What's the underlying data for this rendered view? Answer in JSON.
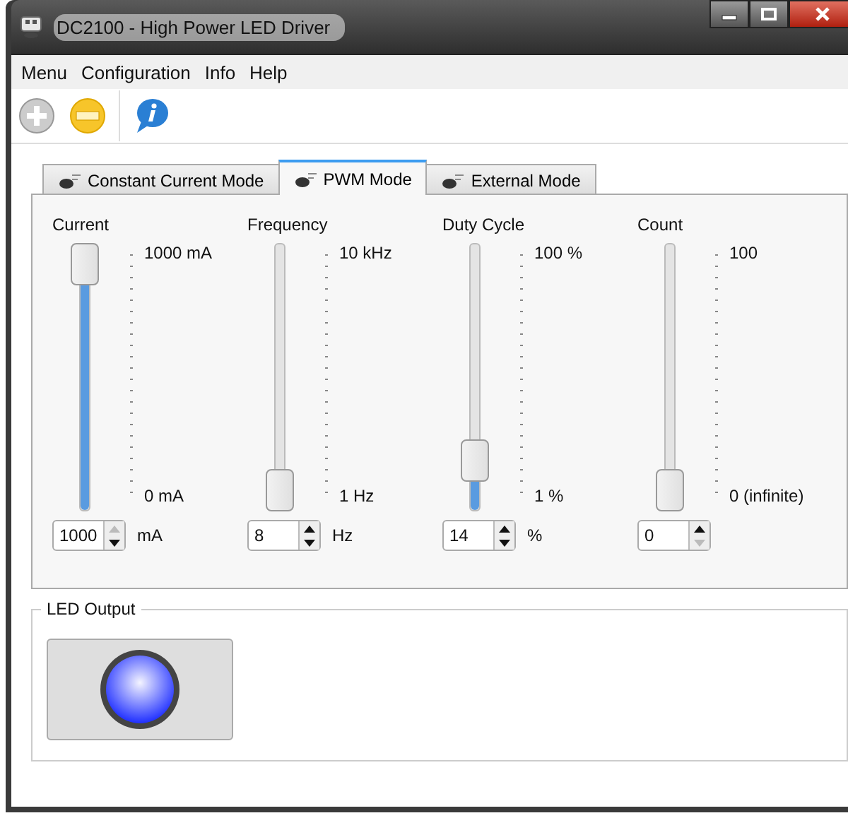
{
  "window": {
    "title": "DC2100 - High Power LED Driver"
  },
  "menu": [
    "Menu",
    "Configuration",
    "Info",
    "Help"
  ],
  "tabs": [
    {
      "label": "Constant Current Mode",
      "selected": false
    },
    {
      "label": "PWM Mode",
      "selected": true
    },
    {
      "label": "External Mode",
      "selected": false
    }
  ],
  "sliders": [
    {
      "name": "Current",
      "max_label": "1000 mA",
      "min_label": "0 mA",
      "level": 1,
      "value": "1000",
      "unit": "mA",
      "up_disabled": true,
      "down_disabled": false
    },
    {
      "name": "Frequency",
      "max_label": "10 kHz",
      "min_label": "1 Hz",
      "level": 0,
      "value": "8",
      "unit": "Hz",
      "up_disabled": false,
      "down_disabled": false
    },
    {
      "name": "Duty Cycle",
      "max_label": "100 %",
      "min_label": "1 %",
      "level": 0.13,
      "value": "14",
      "unit": "%",
      "up_disabled": false,
      "down_disabled": false
    },
    {
      "name": "Count",
      "max_label": "100",
      "min_label": "0 (infinite)",
      "level": 0,
      "value": "0",
      "up_disabled": false,
      "down_disabled": true
    }
  ],
  "led_output": {
    "title": "LED Output",
    "on": true
  }
}
